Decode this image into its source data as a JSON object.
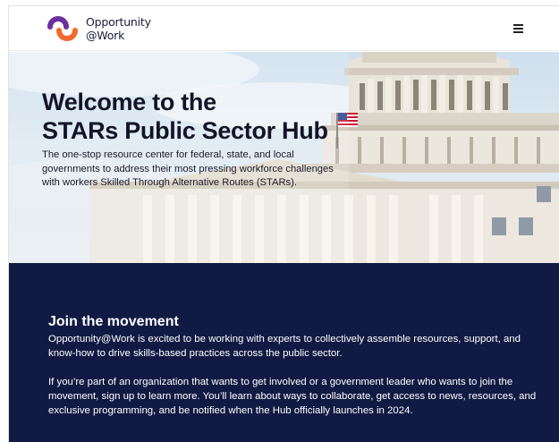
{
  "header": {
    "logo_line1": "Opportunity",
    "logo_line2": "@Work",
    "menu_icon": "hamburger-menu-icon",
    "brand_colors": {
      "purple": "#6b2fa0",
      "orange": "#f26a2c"
    }
  },
  "hero": {
    "title_line1": "Welcome to the",
    "title_line2": "STARs Public Sector Hub",
    "description": "The one-stop resource center for federal, state, and local governments to address their most pressing workforce challenges with workers Skilled Through Alternative Routes (STARs)."
  },
  "join": {
    "title": "Join the movement",
    "paragraph1": "Opportunity@Work is excited to be working with experts to collectively assemble resources, support, and know-how to drive skills-based practices across the public sector.",
    "paragraph2": "If you’re part of an organization that wants to get involved or a government leader who wants to join the movement, sign up to learn more. You’ll learn about ways to collaborate, get access to news, resources, and exclusive programming, and be notified when the Hub officially launches in 2024.",
    "background_color": "#111a43"
  }
}
